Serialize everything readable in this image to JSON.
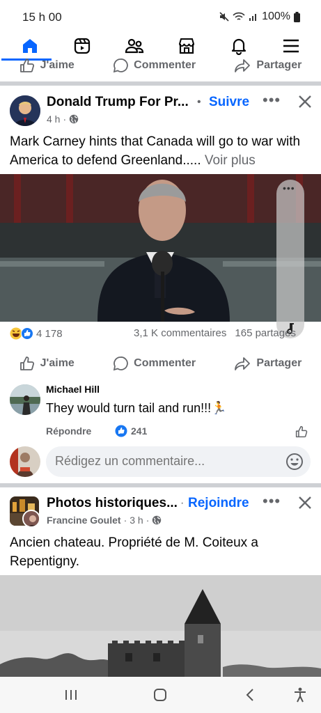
{
  "status_bar": {
    "time": "15 h 00",
    "battery": "100%"
  },
  "nav": {
    "tabs": [
      {
        "name": "home",
        "icon": "home-icon",
        "active": true
      },
      {
        "name": "video",
        "icon": "video-icon"
      },
      {
        "name": "friends",
        "icon": "friends-icon"
      },
      {
        "name": "marketplace",
        "icon": "marketplace-icon"
      },
      {
        "name": "notifications",
        "icon": "bell-icon"
      },
      {
        "name": "menu",
        "icon": "menu-icon"
      }
    ]
  },
  "actions": {
    "like": "J'aime",
    "comment": "Commenter",
    "share": "Partager"
  },
  "post1": {
    "author": "Donald Trump For Pr...",
    "follow": "Suivre",
    "time": "4 h",
    "text": "Mark Carney hints that Canada will go to war with America to defend Greenland.....",
    "see_more": "Voir plus",
    "reaction_count": "4 178",
    "comments_count": "3,1 K commentaires",
    "shares_count": "165 partages",
    "colors": {
      "accent": "#0866ff",
      "secondary": "#65676b"
    }
  },
  "comment": {
    "author": "Michael Hill",
    "text": "They would turn tail and run!!!🏃",
    "reply": "Répondre",
    "likes": "241"
  },
  "composer": {
    "placeholder": "Rédigez un commentaire..."
  },
  "post2": {
    "group": "Photos historiques...",
    "join": "Rejoindre",
    "author": "Francine Goulet",
    "time": "3 h",
    "text": "Ancien chateau. Propriété de M. Coiteux a Repentigny."
  }
}
